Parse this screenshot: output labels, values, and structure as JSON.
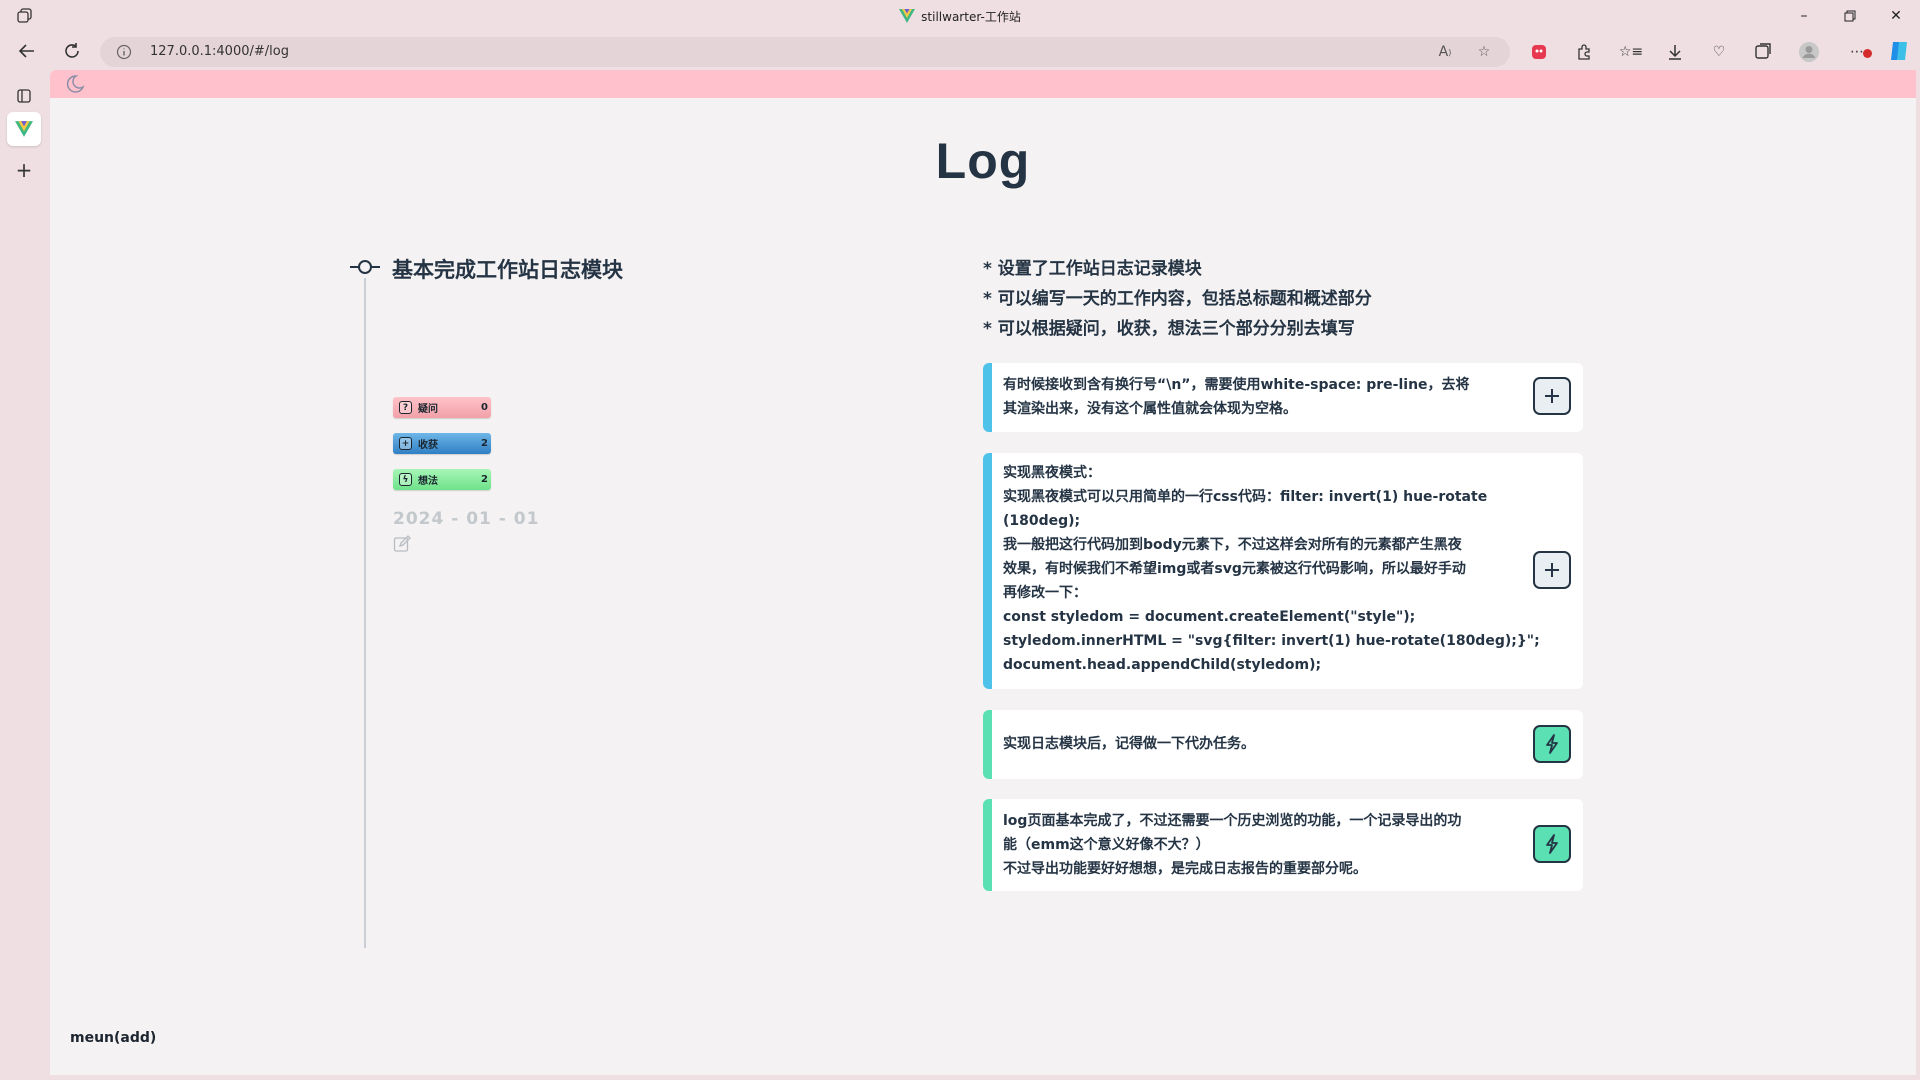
{
  "window": {
    "title": "stillwarter-工作站"
  },
  "browser": {
    "url": "127.0.0.1:4000/#/log",
    "icons": [
      "read-aloud-icon",
      "favorite-star-icon",
      "extension-red-icon",
      "extensions-puzzle-icon",
      "favorites-icon",
      "downloads-icon",
      "browser-essentials-icon",
      "collections-icon",
      "profile-avatar-icon",
      "more-menu-icon",
      "copilot-icon"
    ]
  },
  "page": {
    "title": "Log",
    "entry": {
      "title": "基本完成工作站日志模块",
      "tags": [
        {
          "icon": "?",
          "label": "疑问",
          "count": "0"
        },
        {
          "icon": "+",
          "label": "收获",
          "count": "2"
        },
        {
          "icon": "ϟ",
          "label": "想法",
          "count": "2"
        }
      ],
      "date": "2024 - 01 - 01"
    },
    "summary": [
      "* 设置了工作站日志记录模块",
      "* 可以编写一天的工作内容，包括总标题和概述部分",
      "* 可以根据疑问，收获，想法三个部分分别去填写"
    ],
    "cards": [
      {
        "type": "gain",
        "lines": [
          "有时候接收到含有换行号“\\n”，需要使用white-space: pre-line，去将",
          "其渲染出来，没有这个属性值就会体现为空格。"
        ]
      },
      {
        "type": "gain",
        "lines": [
          "实现黑夜模式：",
          "实现黑夜模式可以只用简单的一行css代码：filter: invert(1) hue-rotate",
          "(180deg);",
          "我一般把这行代码加到body元素下，不过这样会对所有的元素都产生黑夜",
          "效果，有时候我们不希望img或者svg元素被这行代码影响，所以最好手动",
          "再修改一下：",
          "const styledom = document.createElement(\"style\");",
          "styledom.innerHTML = \"svg{filter: invert(1) hue-rotate(180deg);}\";",
          "document.head.appendChild(styledom);"
        ]
      },
      {
        "type": "idea",
        "lines": [
          "实现日志模块后，记得做一下代办任务。"
        ]
      },
      {
        "type": "idea",
        "lines": [
          "log页面基本完成了，不过还需要一个历史浏览的功能，一个记录导出的功",
          "能（emm这个意义好像不大？）",
          "不过导出功能要好好想想，是完成日志报告的重要部分呢。"
        ]
      }
    ],
    "menu": "meun(add)"
  },
  "colors": {
    "topbar": "#ffc2cc",
    "gain_accent": "#4ec2e8",
    "idea_accent": "#5be0b4",
    "text": "#253444"
  }
}
